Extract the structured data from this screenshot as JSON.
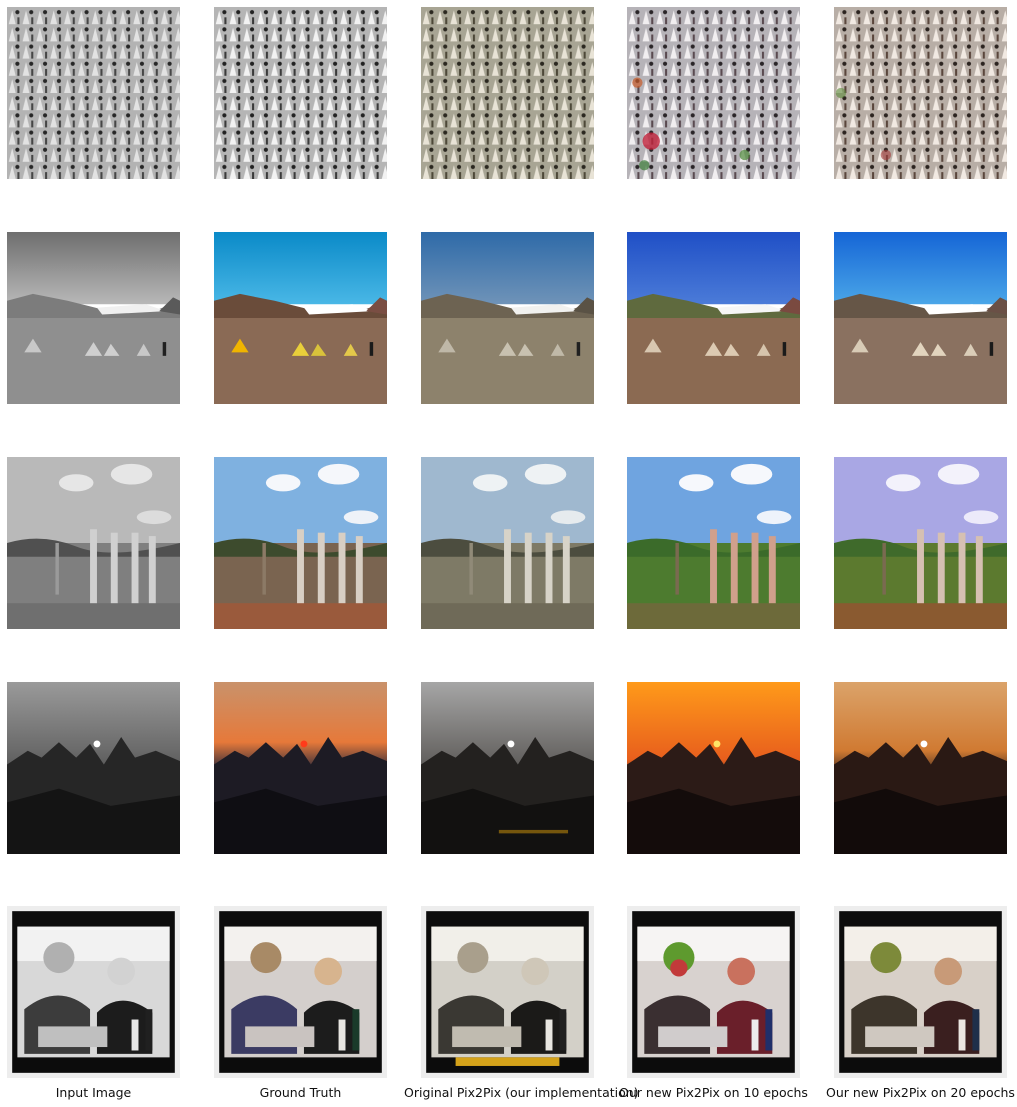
{
  "columns": [
    {
      "label": "Input Image",
      "tone": "gray"
    },
    {
      "label": "Ground Truth",
      "tone": "true"
    },
    {
      "label": "Original Pix2Pix (our implementation)",
      "tone": "muted"
    },
    {
      "label": "Our new Pix2Pix on 10 epochs",
      "tone": "vivid"
    },
    {
      "label": "Our new Pix2Pix on 20 epochs",
      "tone": "warm"
    }
  ],
  "rows": [
    {
      "subject": "crowd of statues"
    },
    {
      "subject": "mountain desert with tents"
    },
    {
      "subject": "ruined columns with trees"
    },
    {
      "subject": "sunset over mountains"
    },
    {
      "subject": "two people at laptop"
    }
  ]
}
